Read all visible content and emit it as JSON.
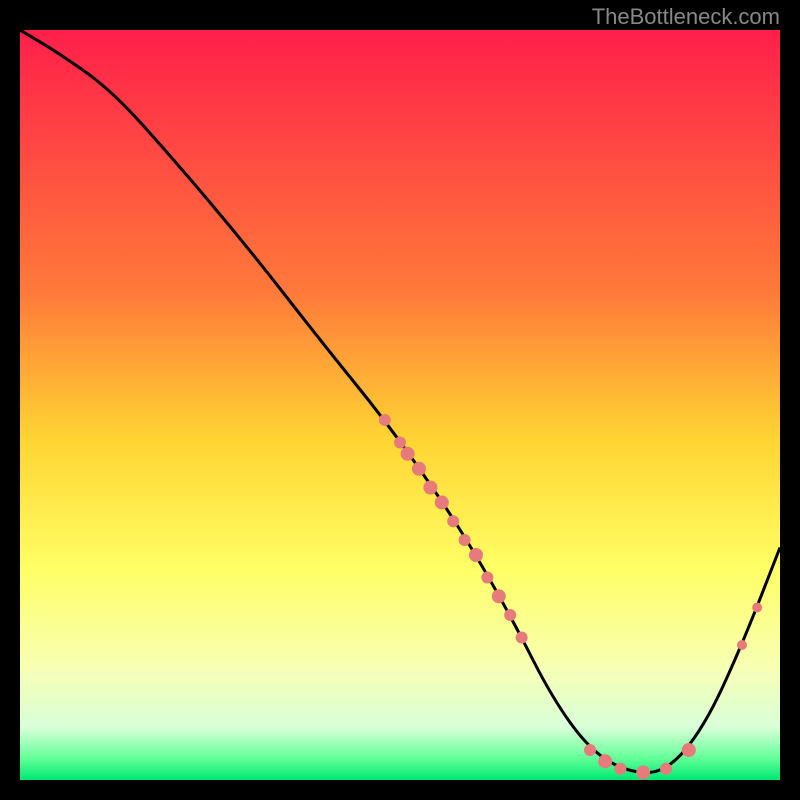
{
  "attribution": "TheBottleneck.com",
  "chart_data": {
    "type": "line",
    "title": "",
    "xlabel": "",
    "ylabel": "",
    "xlim": [
      0,
      100
    ],
    "ylim": [
      0,
      100
    ],
    "background_gradient": {
      "stops": [
        {
          "offset": 0,
          "color": "#ff1f4a"
        },
        {
          "offset": 35,
          "color": "#ff7a3a"
        },
        {
          "offset": 55,
          "color": "#ffd633"
        },
        {
          "offset": 72,
          "color": "#ffff66"
        },
        {
          "offset": 85,
          "color": "#f7ffb3"
        },
        {
          "offset": 93,
          "color": "#d9ffd9"
        },
        {
          "offset": 97,
          "color": "#66ff99"
        },
        {
          "offset": 100,
          "color": "#00e873"
        }
      ]
    },
    "series": [
      {
        "name": "curve",
        "x": [
          0,
          5,
          12,
          20,
          30,
          40,
          48,
          55,
          60,
          65,
          70,
          75,
          80,
          85,
          90,
          95,
          100
        ],
        "y": [
          100,
          97,
          92,
          83,
          71,
          58,
          48,
          38,
          30,
          21,
          11,
          4,
          1,
          1,
          7,
          18,
          31
        ]
      }
    ],
    "markers": [
      {
        "x": 48,
        "y": 48,
        "r": 6
      },
      {
        "x": 50,
        "y": 45,
        "r": 6
      },
      {
        "x": 51,
        "y": 43.5,
        "r": 7
      },
      {
        "x": 52.5,
        "y": 41.5,
        "r": 7
      },
      {
        "x": 54,
        "y": 39,
        "r": 7
      },
      {
        "x": 55.5,
        "y": 37,
        "r": 7
      },
      {
        "x": 57,
        "y": 34.5,
        "r": 6
      },
      {
        "x": 58.5,
        "y": 32,
        "r": 6
      },
      {
        "x": 60,
        "y": 30,
        "r": 7
      },
      {
        "x": 61.5,
        "y": 27,
        "r": 6
      },
      {
        "x": 63,
        "y": 24.5,
        "r": 7
      },
      {
        "x": 64.5,
        "y": 22,
        "r": 6
      },
      {
        "x": 66,
        "y": 19,
        "r": 6
      },
      {
        "x": 75,
        "y": 4,
        "r": 6
      },
      {
        "x": 77,
        "y": 2.5,
        "r": 7
      },
      {
        "x": 79,
        "y": 1.5,
        "r": 6
      },
      {
        "x": 82,
        "y": 1,
        "r": 7
      },
      {
        "x": 85,
        "y": 1.5,
        "r": 6
      },
      {
        "x": 88,
        "y": 4,
        "r": 7
      },
      {
        "x": 95,
        "y": 18,
        "r": 5
      },
      {
        "x": 97,
        "y": 23,
        "r": 5
      }
    ],
    "marker_color": "#e77a7a"
  }
}
